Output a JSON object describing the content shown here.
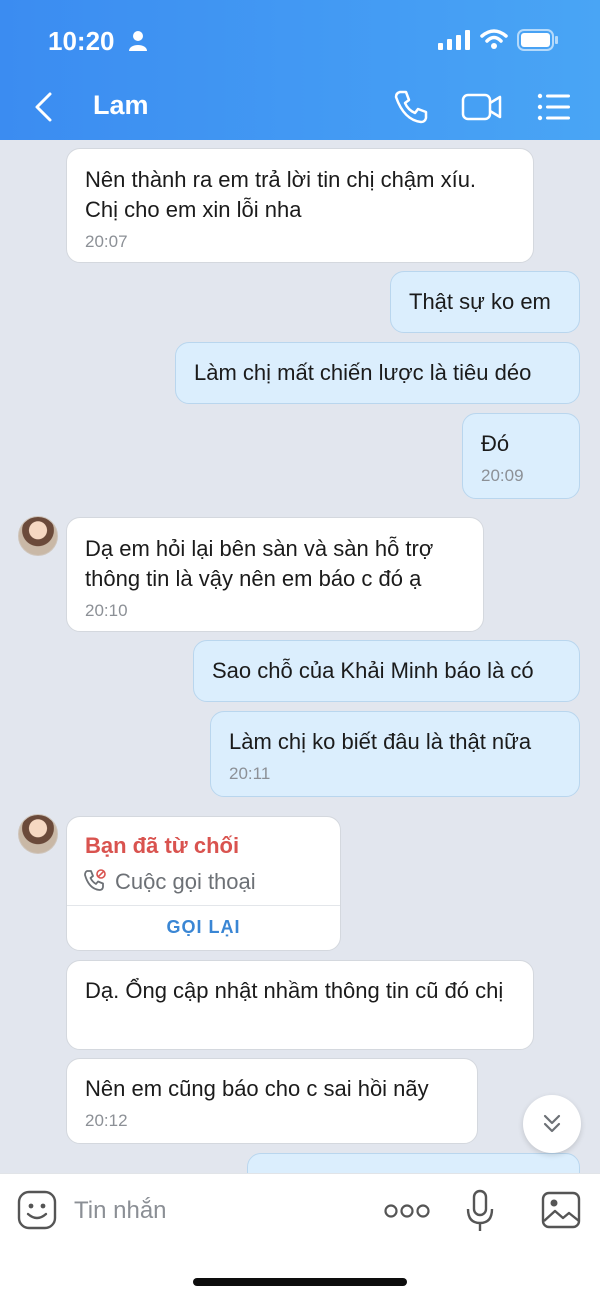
{
  "status_bar": {
    "time": "10:20"
  },
  "header": {
    "title": "Lam"
  },
  "messages": [
    {
      "text": "Nên thành ra em trả lời tin chị chậm xíu. Chị cho em xin lỗi nha",
      "time": "20:07"
    },
    {
      "text": "Thật sự ko em"
    },
    {
      "text": "Làm chị mất chiến lược là tiêu déo"
    },
    {
      "text": "Đó",
      "time": "20:09"
    },
    {
      "text": "Dạ em hỏi lại bên sàn và sàn hỗ trợ thông tin là vậy nên em báo c đó ạ",
      "time": "20:10"
    },
    {
      "text": "Sao chỗ của Khải Minh báo là có"
    },
    {
      "text": "Làm chị ko biết đâu là thật nữa",
      "time": "20:11"
    },
    {
      "text": "Dạ. Ổng cập nhật nhầm thông tin cũ đó chị"
    },
    {
      "text": "Nên em cũng báo cho c sai hồi nãy",
      "time": "20:12"
    }
  ],
  "call_card": {
    "status": "Bạn đã từ chối",
    "type": "Cuộc gọi thoại",
    "action": "GỌI LẠI"
  },
  "input": {
    "placeholder": "Tin nhắn"
  },
  "colors": {
    "header": "#3b8cf1",
    "outgoing_bubble": "#dbeefd",
    "incoming_bubble": "#ffffff",
    "declined": "#d9534f",
    "link": "#3a86d4"
  }
}
